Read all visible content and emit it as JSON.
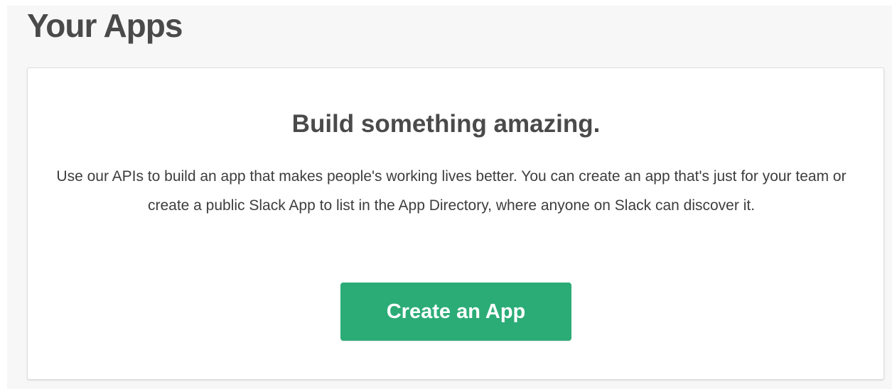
{
  "page": {
    "title": "Your Apps"
  },
  "card": {
    "heading": "Build something amazing.",
    "body": "Use our APIs to build an app that makes people's working lives better. You can create an app that's just for your team or create a public Slack App to list in the App Directory, where anyone on Slack can discover it.",
    "button_label": "Create an App"
  },
  "colors": {
    "page_background": "#f7f7f7",
    "card_background": "#ffffff",
    "button_background": "#2bac76",
    "button_text": "#ffffff",
    "text_primary": "#4a4a4a"
  }
}
